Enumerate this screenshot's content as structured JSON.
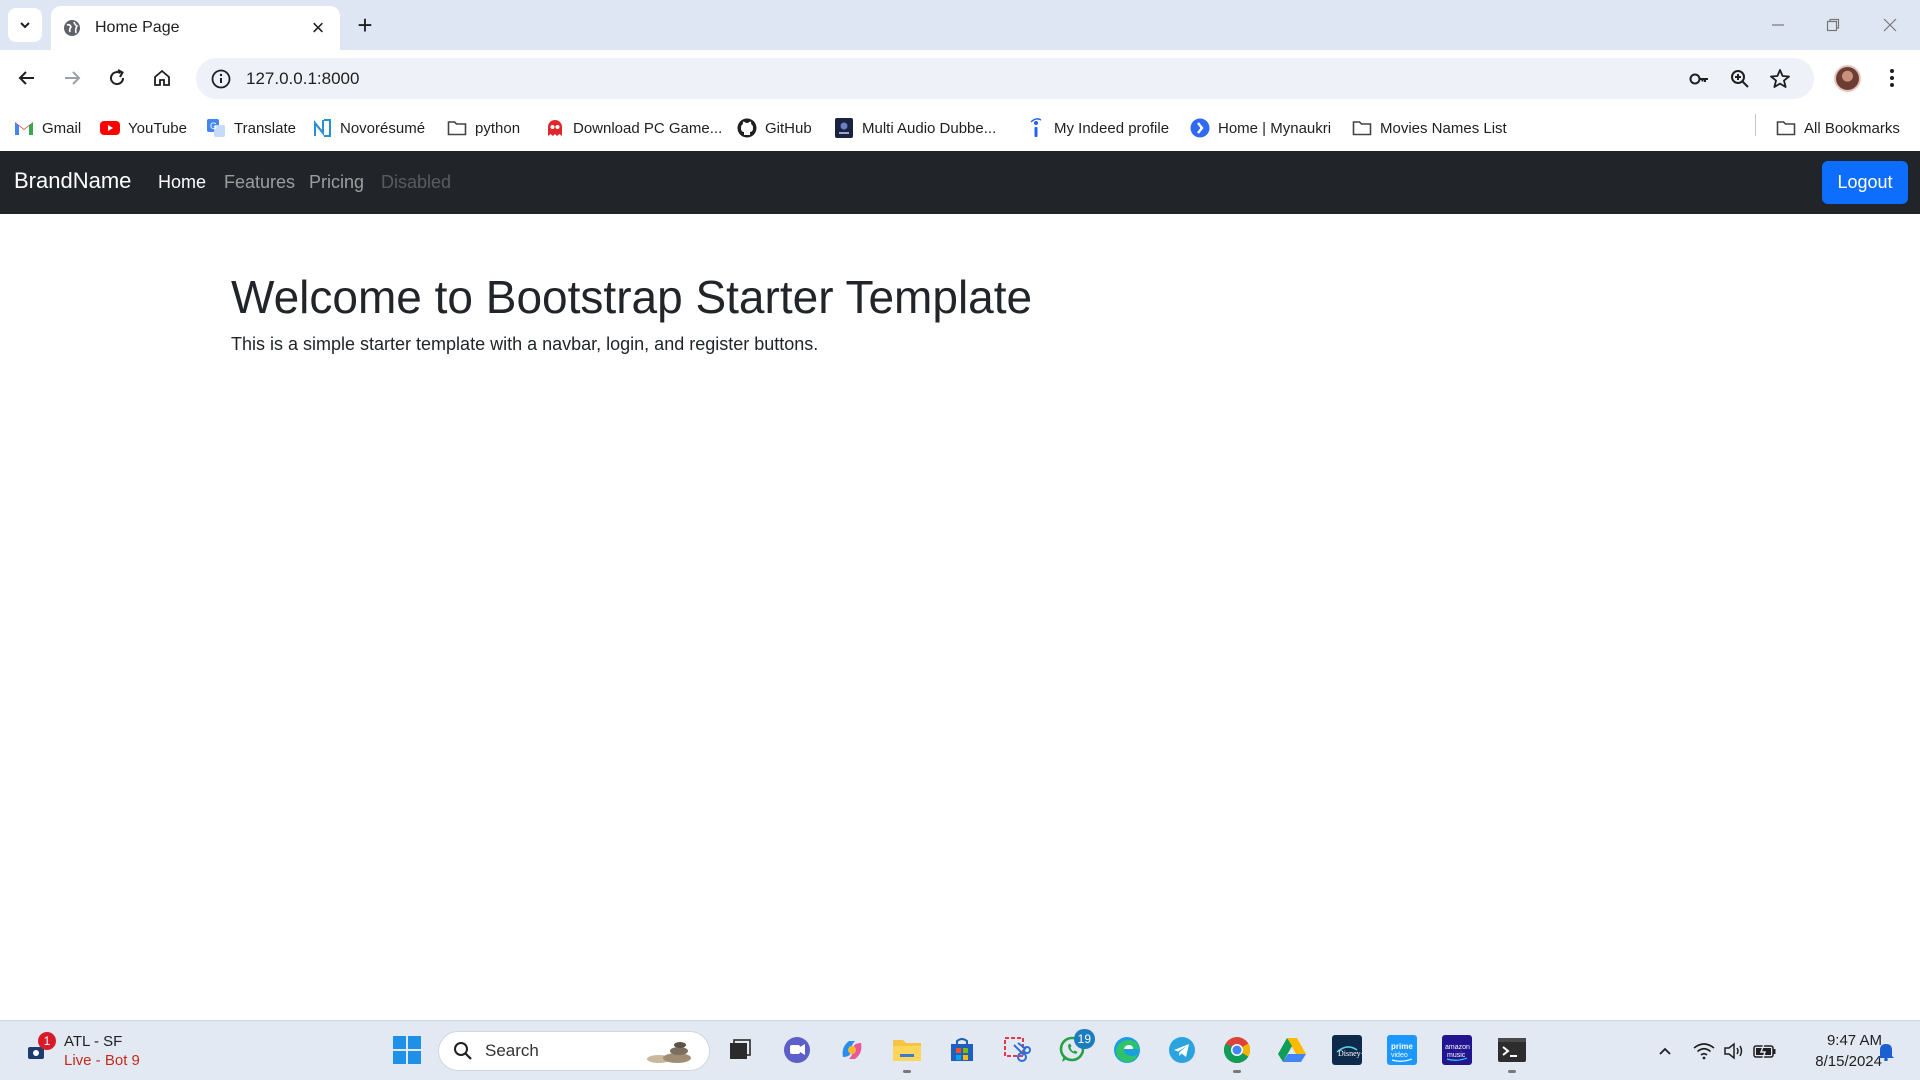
{
  "browser": {
    "tab_title": "Home Page",
    "url": "127.0.0.1:8000",
    "bookmarks": [
      {
        "label": "Gmail",
        "icon": "gmail-icon"
      },
      {
        "label": "YouTube",
        "icon": "youtube-icon"
      },
      {
        "label": "Translate",
        "icon": "translate-icon"
      },
      {
        "label": "Novorésumé",
        "icon": "novoresume-icon"
      },
      {
        "label": "python",
        "icon": "folder-icon"
      },
      {
        "label": "Download PC Game...",
        "icon": "ghost-icon"
      },
      {
        "label": "GitHub",
        "icon": "github-icon"
      },
      {
        "label": "Multi Audio Dubbe...",
        "icon": "movie-icon"
      },
      {
        "label": "My Indeed profile",
        "icon": "indeed-icon"
      },
      {
        "label": "Home | Mynaukri",
        "icon": "naukri-icon"
      },
      {
        "label": "Movies Names List",
        "icon": "folder-icon"
      }
    ],
    "all_bookmarks": "All Bookmarks"
  },
  "page": {
    "brand": "BrandName",
    "nav_links": [
      {
        "label": "Home",
        "state": "active"
      },
      {
        "label": "Features",
        "state": "normal"
      },
      {
        "label": "Pricing",
        "state": "normal"
      },
      {
        "label": "Disabled",
        "state": "disabled"
      }
    ],
    "logout_label": "Logout",
    "hero_title": "Welcome to Bootstrap Starter Template",
    "hero_text": "This is a simple starter template with a navbar, login, and register buttons."
  },
  "taskbar": {
    "weather_badge": "1",
    "weather_line1": "ATL - SF",
    "weather_line2": "Live - Bot 9",
    "search_label": "Search",
    "whatsapp_badge": "19",
    "time": "9:47 AM",
    "date": "8/15/2024"
  },
  "colors": {
    "navbar_bg": "#212529",
    "primary_button": "#0d6efd",
    "tabstrip_bg": "#dfe6f3",
    "taskbar_bg": "#e3e9f3"
  }
}
